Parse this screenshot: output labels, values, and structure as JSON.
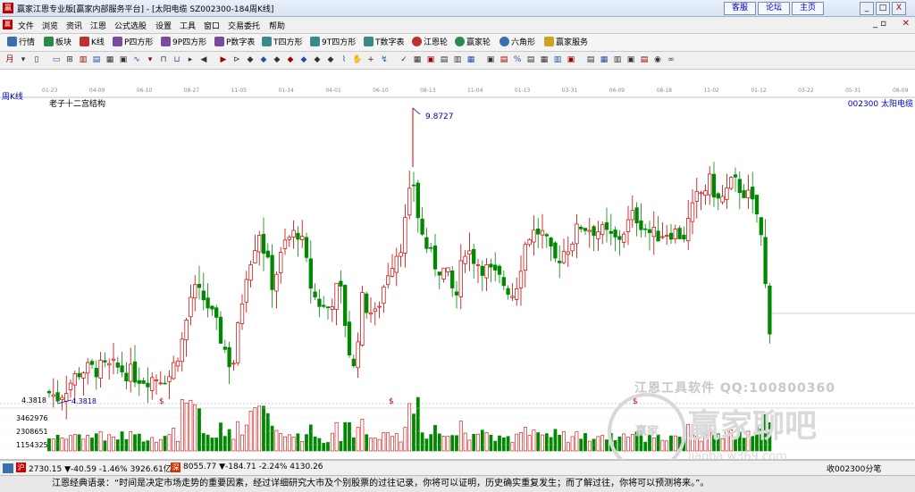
{
  "window": {
    "title": "赢家江恩专业版[赢家内部服务平台] - [太阳电缆  SZ002300-184周K线]",
    "links": [
      "客服",
      "论坛",
      "主页"
    ],
    "buttons": [
      "_",
      "□",
      "X"
    ]
  },
  "menu": [
    "文件",
    "浏览",
    "资讯",
    "江恩",
    "公式选股",
    "设置",
    "工具",
    "窗口",
    "交易委托",
    "帮助"
  ],
  "nav": [
    {
      "label": "行情",
      "icon": "grid-icon"
    },
    {
      "label": "板块",
      "icon": "blocks-icon"
    },
    {
      "label": "K线",
      "icon": "candle-icon"
    },
    {
      "label": "P四方形",
      "icon": "p-square-icon"
    },
    {
      "label": "9P四方形",
      "icon": "9p-square-icon"
    },
    {
      "label": "P数字表",
      "icon": "p-table-icon"
    },
    {
      "label": "T四方形",
      "icon": "t-square-icon"
    },
    {
      "label": "9T四方形",
      "icon": "9t-square-icon"
    },
    {
      "label": "T数字表",
      "icon": "t-table-icon"
    },
    {
      "label": "江恩轮",
      "icon": "wheel-icon"
    },
    {
      "label": "赢家轮",
      "icon": "winner-wheel-icon"
    },
    {
      "label": "六角形",
      "icon": "hexagon-icon"
    },
    {
      "label": "赢家服务",
      "icon": "dollar-icon"
    }
  ],
  "chart": {
    "period_label": "周K线",
    "title": "老子十二宫结构",
    "stock": "002300  太阳电缆",
    "high_label": "9.8727",
    "low_label": "4.3818",
    "low_axis_label": "4.3818",
    "volume_ticks": [
      "3462976",
      "2308651",
      "1154325"
    ],
    "dates": [
      "01-23",
      "04-09",
      "06-10",
      "08-27",
      "11-05",
      "01-14",
      "04-01",
      "06-10",
      "08-13",
      "11-04",
      "01-13",
      "03-31",
      "06-09",
      "08-18",
      "11-02",
      "01-12",
      "03-22",
      "05-31",
      "08-09"
    ]
  },
  "watermark": {
    "line1": "江恩工具软件  QQ:100800360",
    "logo": "赢家",
    "big": "赢家聊吧",
    "url": "liaoba.w369.com"
  },
  "status": {
    "sh": "2730.15 ▼-40.59 -1.46% 3926.61亿",
    "sz": "8055.77 ▼-184.71 -2.24% 4130.26",
    "right": "收002300分笔"
  },
  "quote": "江恩经典语录：“时间是决定市场走势的重要因素，经过详细研究大市及个别股票的过往记录，你将可以证明，历史确实重复发生；而了解过往，你将可以预测将来。”。",
  "colors": {
    "up": "#cc0000",
    "down": "#008800",
    "accent": "#0000cc"
  }
}
